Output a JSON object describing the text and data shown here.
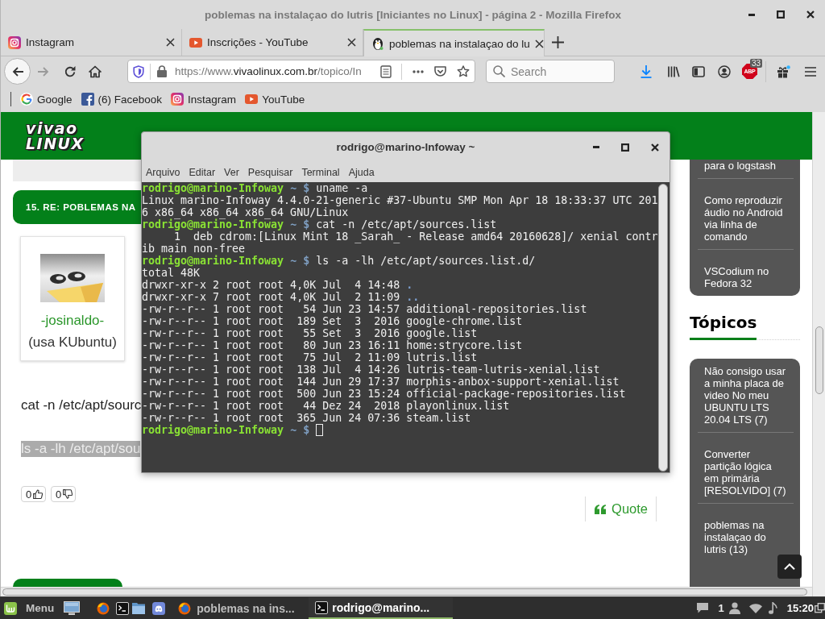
{
  "window": {
    "title": "poblemas na instalaçao do lutris [Iniciantes no Linux] - página 2 - Mozilla Firefox"
  },
  "tabs": [
    {
      "label": "Instagram",
      "kind": "instagram",
      "selected": false
    },
    {
      "label": "Inscrições - YouTube",
      "kind": "youtube",
      "selected": false
    },
    {
      "label": "poblemas na instalaçao do lu",
      "kind": "site",
      "selected": true
    }
  ],
  "navigation": [
    {
      "kind": "back",
      "disabled": false
    },
    {
      "kind": "forward",
      "disabled": true
    },
    {
      "kind": "reload",
      "disabled": false
    },
    {
      "kind": "home",
      "disabled": false
    }
  ],
  "address_bar": {
    "prefix": "https://www.",
    "domain": "vivaolinux.com.br",
    "path": "/topico/In"
  },
  "search": {
    "placeholder": "Search"
  },
  "adblock": {
    "label": "ABP",
    "badge": "33"
  },
  "bookmarks": [
    {
      "label": "Google",
      "kind": "google"
    },
    {
      "label": "(6) Facebook",
      "kind": "facebook"
    },
    {
      "label": "Instagram",
      "kind": "instagram"
    },
    {
      "label": "YouTube",
      "kind": "youtube"
    }
  ],
  "page": {
    "logo": [
      "vivao",
      "LINUX"
    ],
    "post": {
      "heading": "15. RE: POBLEMAS NA",
      "author": "-josinaldo-",
      "author_note": "(usa KUbuntu)",
      "lines": [
        {
          "text": "cat -n /etc/apt/sourc",
          "selected": false
        },
        {
          "text": "ls -a -lh /etc/apt/sou",
          "selected": true
        }
      ],
      "votes": [
        {
          "count": "0",
          "kind": "up"
        },
        {
          "count": "0",
          "kind": "down"
        }
      ],
      "quote": "Quote"
    },
    "sidebar": {
      "articles": [
        "para o logstash",
        "Como reproduzir áudio no Android via linha de comando",
        "VSCodium no Fedora 32"
      ],
      "heading": "Tópicos",
      "topics": [
        "Não consigo usar a minha placa de video No meu UBUNTU LTS 20.04 LTS (7)",
        "Converter partição lógica em primária [RESOLVIDO] (7)",
        "poblemas na instalaçao do lutris (13)"
      ]
    }
  },
  "terminal": {
    "title": "rodrigo@marino-Infoway ~",
    "menu": [
      "Arquivo",
      "Editar",
      "Ver",
      "Pesquisar",
      "Terminal",
      "Ajuda"
    ],
    "lines": [
      {
        "kind": "prompt",
        "user": "rodrigo@marino-Infoway",
        "marker": "~ $",
        "command": "uname -a"
      },
      {
        "kind": "output",
        "text": "Linux marino-Infoway 4.4.0-21-generic #37-Ubuntu SMP Mon Apr 18 18:33:37 UTC 201"
      },
      {
        "kind": "output",
        "text": "6 x86_64 x86_64 x86_64 GNU/Linux"
      },
      {
        "kind": "prompt",
        "user": "rodrigo@marino-Infoway",
        "marker": "~ $",
        "command": "cat -n /etc/apt/sources.list"
      },
      {
        "kind": "output",
        "text": "     1  deb cdrom:[Linux Mint 18 _Sarah_ - Release amd64 20160628]/ xenial contr"
      },
      {
        "kind": "output",
        "text": "ib main non-free"
      },
      {
        "kind": "prompt",
        "user": "rodrigo@marino-Infoway",
        "marker": "~ $",
        "command": "ls -a -lh /etc/apt/sources.list.d/"
      },
      {
        "kind": "output",
        "text": "total 48K"
      },
      {
        "kind": "directory",
        "meta": "drwxr-xr-x 2 root root 4,0K Jul  4 14:48",
        "name": "."
      },
      {
        "kind": "directory",
        "meta": "drwxr-xr-x 7 root root 4,0K Jul  2 11:09",
        "name": ".."
      },
      {
        "kind": "file",
        "meta": "-rw-r--r-- 1 root root   54 Jun 23 14:57",
        "name": "additional-repositories.list"
      },
      {
        "kind": "file",
        "meta": "-rw-r--r-- 1 root root  189 Set  3  2016",
        "name": "google-chrome.list"
      },
      {
        "kind": "file",
        "meta": "-rw-r--r-- 1 root root   55 Set  3  2016",
        "name": "google.list"
      },
      {
        "kind": "file",
        "meta": "-rw-r--r-- 1 root root   80 Jun 23 16:11",
        "name": "home:strycore.list"
      },
      {
        "kind": "file",
        "meta": "-rw-r--r-- 1 root root   75 Jul  2 11:09",
        "name": "lutris.list"
      },
      {
        "kind": "file",
        "meta": "-rw-r--r-- 1 root root  138 Jul  4 14:26",
        "name": "lutris-team-lutris-xenial.list"
      },
      {
        "kind": "file",
        "meta": "-rw-r--r-- 1 root root  144 Jun 29 17:37",
        "name": "morphis-anbox-support-xenial.list"
      },
      {
        "kind": "file",
        "meta": "-rw-r--r-- 1 root root  500 Jun 23 15:24",
        "name": "official-package-repositories.list"
      },
      {
        "kind": "file",
        "meta": "-rw-r--r-- 1 root root   44 Dez 24  2018",
        "name": "playonlinux.list"
      },
      {
        "kind": "file",
        "meta": "-rw-r--r-- 1 root root  365 Jun 24 07:36",
        "name": "steam.list"
      },
      {
        "kind": "prompt",
        "user": "rodrigo@marino-Infoway",
        "marker": "~ $",
        "cursor": true
      }
    ]
  },
  "taskbar": {
    "menu": "Menu",
    "tasks": [
      {
        "label": "poblemas na ins...",
        "kind": "browser",
        "selected": false
      },
      {
        "label": "rodrigo@marino...",
        "kind": "terminal",
        "selected": true
      }
    ],
    "notifications": "1",
    "clock": "15:20"
  }
}
